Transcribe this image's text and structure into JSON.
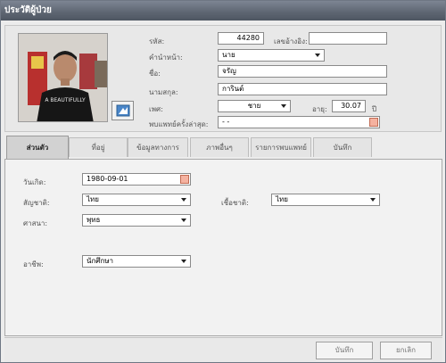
{
  "window": {
    "title": "ประวัติผู้ป่วย"
  },
  "header": {
    "code_label": "รหัส:",
    "code_value": "44280",
    "idcard_label": "เลขอ้างอิง:",
    "idcard_value": "",
    "prefix_label": "คำนำหน้า:",
    "prefix_value": "นาย",
    "firstname_label": "ชื่อ:",
    "firstname_value": "จรัญ",
    "lastname_label": "นามสกุล:",
    "lastname_value": "การินต์",
    "sex_label": "เพศ:",
    "sex_value": "ชาย",
    "age_label": "อายุ:",
    "age_value": "30.07",
    "age_unit": "ปี",
    "lastvisit_label": "พบแพทย์ครั้งล่าสุด:",
    "lastvisit_value": "- -"
  },
  "tabs": [
    {
      "label": "ส่วนตัว"
    },
    {
      "label": "ที่อยู่"
    },
    {
      "label": "ข้อมูลทางการแพทย์"
    },
    {
      "label": "ภาพอื่นๆ"
    },
    {
      "label": "รายการพบแพทย์"
    },
    {
      "label": "บันทึก"
    }
  ],
  "personal": {
    "birth_label": "วันเกิด:",
    "birth_value": "1980-09-01",
    "nationality_label": "สัญชาติ:",
    "nationality_value": "ไทย",
    "race_label": "เชื้อชาติ:",
    "race_value": "ไทย",
    "religion_label": "ศาสนา:",
    "religion_value": "พุทธ",
    "occupation_label": "อาชีพ:",
    "occupation_value": "นักศึกษา"
  },
  "footer": {
    "save_label": "บันทึก",
    "cancel_label": "ยกเลิก"
  },
  "photo": {
    "shirt_text": "A BEAUTIFULLY"
  }
}
